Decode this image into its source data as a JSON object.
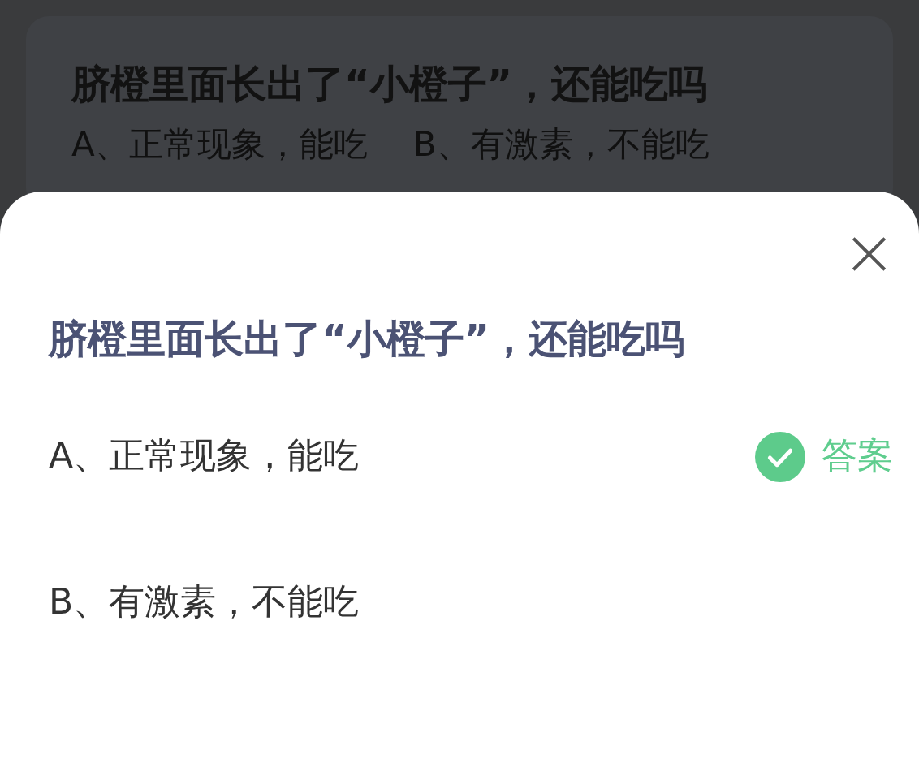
{
  "background": {
    "question": "脐橙里面长出了“小橙子”，还能吃吗",
    "options": [
      "A、正常现象，能吃",
      "B、有激素，不能吃"
    ]
  },
  "dialog": {
    "close": "×",
    "question": "脐橙里面长出了“小橙子”，还能吃吗",
    "answer_label": "答案",
    "options": [
      {
        "text": "A、正常现象，能吃",
        "correct": true
      },
      {
        "text": "B、有激素，不能吃",
        "correct": false
      }
    ]
  }
}
